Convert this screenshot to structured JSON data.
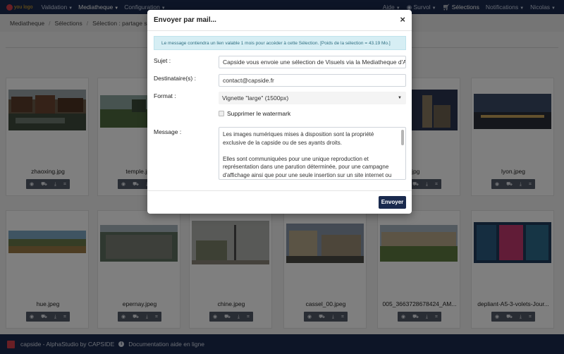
{
  "navbar": {
    "logo_text": "you logo",
    "left_items": [
      {
        "label": "Validation"
      },
      {
        "label": "Mediatheque"
      },
      {
        "label": "Configuration"
      }
    ],
    "right_items": {
      "aide": "Aide",
      "survol": "Survol",
      "selections": "Sélections",
      "notifications": "Notifications",
      "user": "Nicolas"
    }
  },
  "breadcrumb": [
    "Mediatheque",
    "Sélections",
    "Sélection : partage shooting"
  ],
  "thumbnails": [
    {
      "name": "zhaoxing.jpg"
    },
    {
      "name": "temple.jpg"
    },
    {
      "name": ""
    },
    {
      "name": ""
    },
    {
      "name": "mai.jpg"
    },
    {
      "name": "lyon.jpeg"
    },
    {
      "name": "hue.jpeg"
    },
    {
      "name": "epernay.jpeg"
    },
    {
      "name": "chine.jpeg"
    },
    {
      "name": "cassel_00.jpeg"
    },
    {
      "name": "005_3663728678424_AM..."
    },
    {
      "name": "depliant-A5-3-volets-Jour..."
    }
  ],
  "tool_icons": [
    "eye-icon",
    "cart-icon",
    "download-icon",
    "crop-icon"
  ],
  "modal": {
    "title": "Envoyer par mail...",
    "close": "×",
    "alert": "Le message contiendra un lien valable 1 mois pour accéder à cette Sélection. [Poids de la sélection = 43.19 Mo.]",
    "subject_label": "Sujet :",
    "subject_value": "Capside vous envoie une sélection de Visuels via la Mediatheque d'Alphast",
    "recipients_label": "Destinataire(s) :",
    "recipients_value": "contact@capside.fr",
    "format_label": "Format :",
    "format_value": "Vignette \"large\" (1500px)",
    "watermark_label": "Supprimer le watermark",
    "message_label": "Message :",
    "message_p1": "Les images numériques mises à disposition sont la propriété exclusive de la capside ou de ses ayants droits.",
    "message_p2": "Elles sont communiquées pour une unique reproduction et représentation dans une parution déterminée, pour une campagne d'affichage ainsi que pour une seule insertion sur un site internet ou un",
    "send_label": "Envoyer"
  },
  "footer": {
    "brand": "capside - AlphaStudio by CAPSIDE",
    "doc_link": "Documentation aide en ligne"
  },
  "colors": {
    "navbar": "#1a2a4e",
    "alert_bg": "#d6eef4",
    "send_button": "#1a2a4e"
  }
}
